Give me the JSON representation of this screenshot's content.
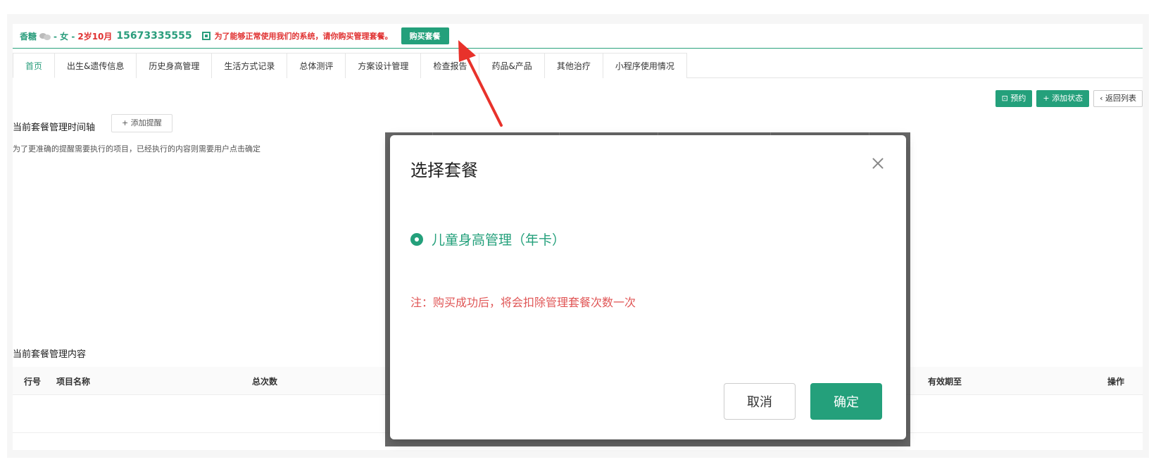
{
  "header": {
    "name": "香糖",
    "gender": "- 女 -",
    "age": "2岁10月",
    "phone": "15673335555",
    "warning": "为了能够正常使用我们的系统，请你购买管理套餐。",
    "buy_label": "购买套餐"
  },
  "tabs": [
    {
      "label": "首页",
      "active": true
    },
    {
      "label": "出生&遗传信息"
    },
    {
      "label": "历史身高管理"
    },
    {
      "label": "生活方式记录"
    },
    {
      "label": "总体测评"
    },
    {
      "label": "方案设计管理"
    },
    {
      "label": "检查报告"
    },
    {
      "label": "药品&产品"
    },
    {
      "label": "其他治疗"
    },
    {
      "label": "小程序使用情况"
    }
  ],
  "actions": {
    "appointment": "预约",
    "add_status": "+ 添加状态",
    "back_to_list": "返回列表"
  },
  "timeline": {
    "title": "当前套餐管理时间轴",
    "add_reminder": "+ 添加提醒",
    "note": "为了更准确的提醒需要执行的项目，已经执行的内容则需要用户点击确定"
  },
  "content": {
    "title": "当前套餐管理内容",
    "columns": [
      "行号",
      "项目名称",
      "总次数",
      "有效期至",
      "操作"
    ]
  },
  "modal": {
    "title": "选择套餐",
    "option": "儿童身高管理（年卡）",
    "note": "注：购买成功后，将会扣除管理套餐次数一次",
    "cancel": "取消",
    "confirm": "确定"
  },
  "colors": {
    "accent": "#24a07b",
    "warning": "#e03131",
    "arrow": "#e8322b"
  }
}
